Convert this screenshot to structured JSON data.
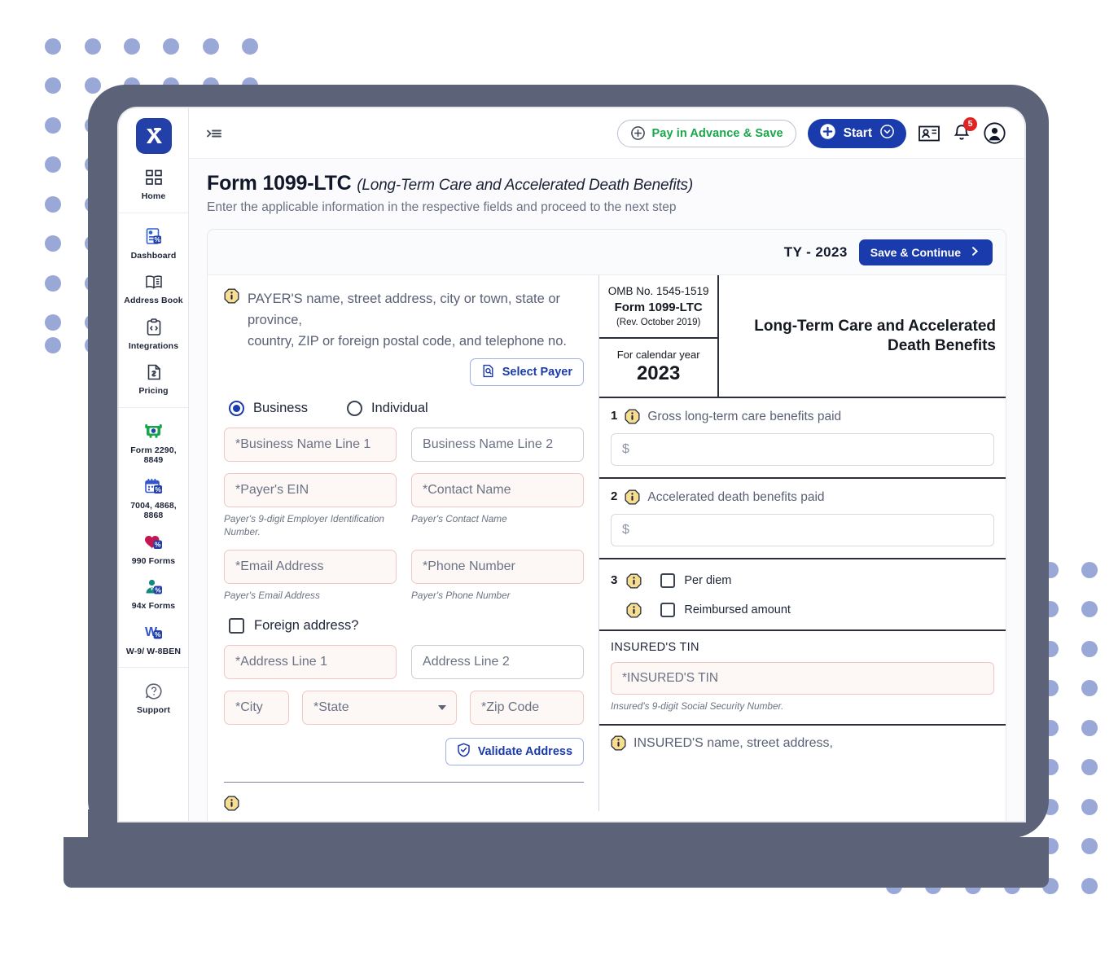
{
  "app": {
    "logo_alt": "logo-mark"
  },
  "sidebar": {
    "sections": [
      {
        "items": [
          {
            "icon": "grid-icon",
            "label": "Home"
          }
        ]
      },
      {
        "items": [
          {
            "icon": "dashboard-icon",
            "label": "Dashboard"
          },
          {
            "icon": "address-book-icon",
            "label": "Address Book"
          },
          {
            "icon": "integrations-icon",
            "label": "Integrations"
          },
          {
            "icon": "pricing-icon",
            "label": "Pricing"
          }
        ]
      },
      {
        "items": [
          {
            "icon": "truck-icon",
            "label": "Form 2290, 8849"
          },
          {
            "icon": "calendar-icon",
            "label": "7004, 4868, 8868"
          },
          {
            "icon": "heart-icon",
            "label": "990 Forms"
          },
          {
            "icon": "person-icon",
            "label": "94x Forms"
          },
          {
            "icon": "w-icon",
            "label": "W-9/ W-8BEN"
          }
        ]
      },
      {
        "items": [
          {
            "icon": "help-icon",
            "label": "Support"
          }
        ]
      }
    ]
  },
  "topbar": {
    "collapse_icon": "collapse-sidebar-icon",
    "pay_advance_label": "Pay in Advance & Save",
    "start_label": "Start",
    "contacts_icon": "contact-card-icon",
    "bell_icon": "notification-bell-icon",
    "notification_count": "5",
    "avatar_icon": "user-avatar-icon"
  },
  "page": {
    "title": "Form 1099-LTC",
    "title_sub": "(Long-Term Care and Accelerated Death Benefits)",
    "description": "Enter the applicable information in the respective fields and proceed to the next step"
  },
  "card": {
    "tax_year": "TY - 2023",
    "save_label": "Save & Continue"
  },
  "payer": {
    "heading_line1": "PAYER'S name, street address, city or town, state or province,",
    "heading_line2": "country, ZIP or foreign postal code, and telephone no.",
    "select_payer_label": "Select Payer",
    "entity_options": [
      {
        "label": "Business",
        "selected": true
      },
      {
        "label": "Individual",
        "selected": false
      }
    ],
    "fields": {
      "business_name_1": "*Business Name Line 1",
      "business_name_2": "Business Name Line 2",
      "ein": "*Payer's EIN",
      "ein_hint": "Payer's 9-digit Employer Identification Number.",
      "contact_name": "*Contact Name",
      "contact_name_hint": "Payer's Contact Name",
      "email": "*Email Address",
      "email_hint": "Payer's Email Address",
      "phone": "*Phone Number",
      "phone_hint": "Payer's Phone Number",
      "foreign_address": "Foreign address?",
      "address_1": "*Address Line 1",
      "address_2": "Address Line 2",
      "city": "*City",
      "state": "*State",
      "zip": "*Zip Code"
    },
    "validate_label": "Validate Address"
  },
  "preview": {
    "omb_no": "OMB No. 1545-1519",
    "form_name": "Form 1099-LTC",
    "revision": "(Rev. October 2019)",
    "calendar_year_label": "For calendar year",
    "calendar_year": "2023",
    "form_title": "Long-Term Care and Accelerated Death Benefits",
    "box1": {
      "num": "1",
      "label": "Gross long-term care benefits paid",
      "value_prefix": "$"
    },
    "box2": {
      "num": "2",
      "label": "Accelerated death benefits paid",
      "value_prefix": "$"
    },
    "box3": {
      "num": "3",
      "checkboxes": [
        {
          "label": "Per diem",
          "checked": false
        },
        {
          "label": "Reimbursed amount",
          "checked": false
        }
      ]
    },
    "tin": {
      "title": "INSURED'S TIN",
      "placeholder": "*INSURED'S TIN",
      "hint": "Insured's 9-digit Social Security Number."
    },
    "insured_heading": "INSURED'S name, street address,"
  },
  "colors": {
    "brand_blue": "#1a3bab",
    "accent_green": "#1aa64b",
    "badge_red": "#e02424",
    "chassis": "#5c6378",
    "dot": "#9aa8d8"
  }
}
